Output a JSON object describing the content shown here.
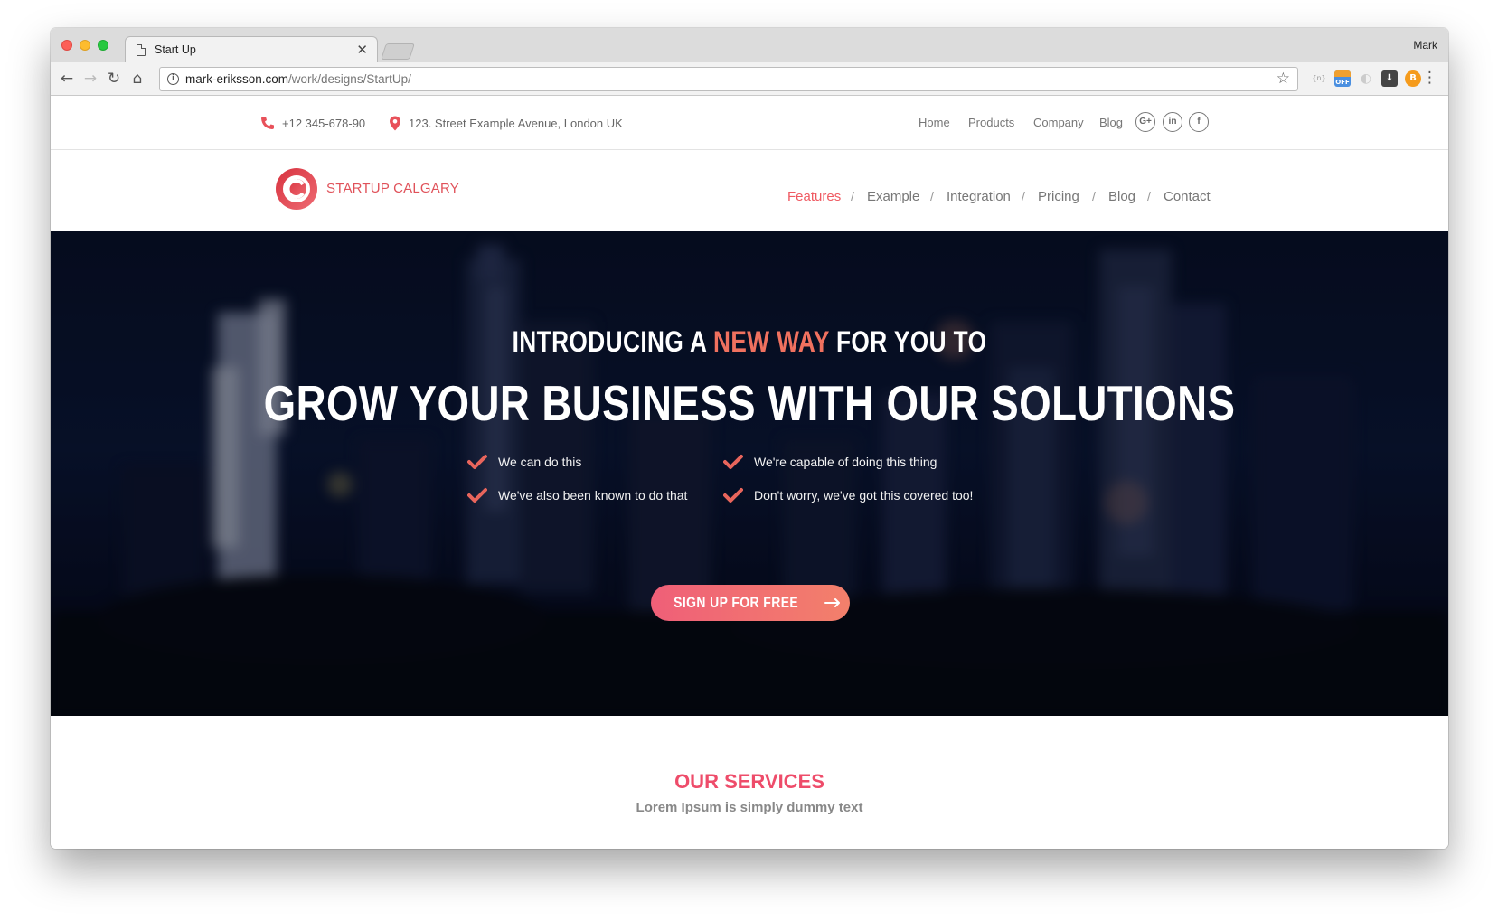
{
  "browser": {
    "tab_title": "Start Up",
    "profile_name": "Mark",
    "url_host": "mark-eriksson.com",
    "url_path": "/work/designs/StartUp/",
    "extension_off_label": "OFF",
    "extension_json_label": "{n}",
    "extension_btc_label": "B"
  },
  "topbar": {
    "phone": "+12 345-678-90",
    "address": "123. Street Example Avenue, London UK",
    "links": [
      "Home",
      "Products",
      "Company",
      "Blog"
    ],
    "social": [
      "G+",
      "in",
      "f"
    ]
  },
  "brand": {
    "name": "STARTUP CALGARY",
    "color": "#e0525a"
  },
  "nav": {
    "items": [
      "Features",
      "Example",
      "Integration",
      "Pricing",
      "Blog",
      "Contact"
    ],
    "active": "Features",
    "separator": "/"
  },
  "hero": {
    "line1_pre": "INTRODUCING A ",
    "line1_accent": "NEW WAY",
    "line1_post": " FOR YOU TO",
    "line2": "GROW YOUR BUSINESS WITH OUR SOLUTIONS",
    "features": [
      "We can do this",
      "We're capable of doing this thing",
      "We've also been known to do that",
      "Don't worry, we've got this covered too!"
    ],
    "cta_label": "SIGN UP FOR FREE",
    "accent_color": "#f0715f"
  },
  "services": {
    "title": "OUR SERVICES",
    "subtitle": "Lorem Ipsum is simply dummy text"
  }
}
